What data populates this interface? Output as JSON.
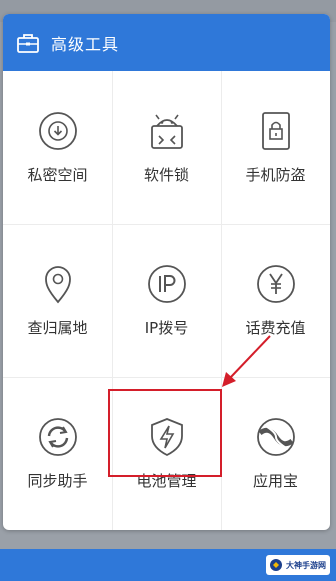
{
  "dialog": {
    "title": "高级工具",
    "title_icon": "toolbox-icon"
  },
  "tools": [
    {
      "label": "私密空间",
      "icon": "download-circle-icon"
    },
    {
      "label": "软件锁",
      "icon": "android-lock-icon"
    },
    {
      "label": "手机防盗",
      "icon": "phone-lock-icon"
    },
    {
      "label": "查归属地",
      "icon": "location-pin-icon"
    },
    {
      "label": "IP拨号",
      "icon": "ip-dial-icon"
    },
    {
      "label": "话费充值",
      "icon": "yen-circle-icon"
    },
    {
      "label": "同步助手",
      "icon": "sync-icon"
    },
    {
      "label": "电池管理",
      "icon": "battery-shield-icon"
    },
    {
      "label": "应用宝",
      "icon": "app-store-icon"
    }
  ],
  "highlighted_tool": "电池管理",
  "watermark": {
    "text": "大神手游网"
  },
  "colors": {
    "accent": "#2f78d9",
    "highlight": "#d41e2a",
    "icon_stroke": "#555555"
  }
}
